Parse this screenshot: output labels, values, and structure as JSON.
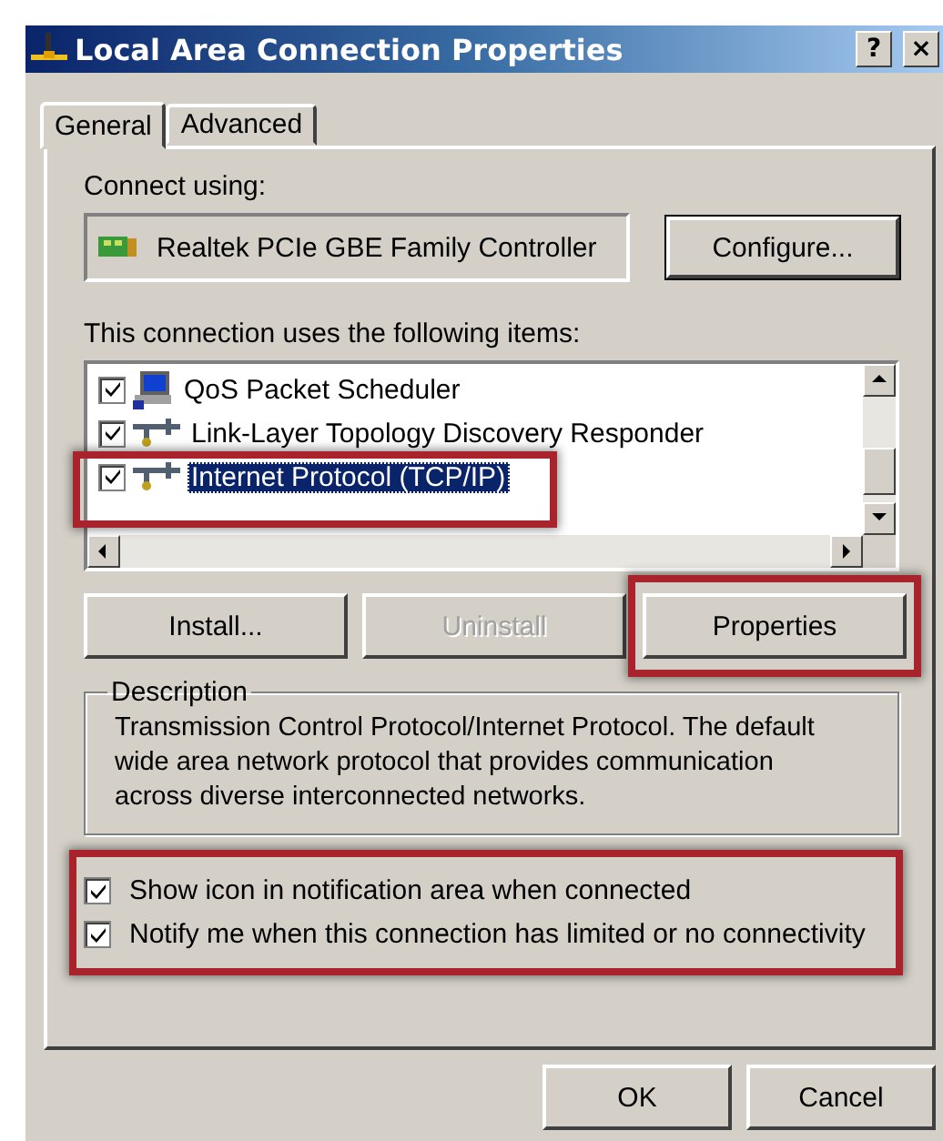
{
  "window": {
    "title": "Local Area Connection Properties",
    "buttons": [
      "?",
      "×"
    ]
  },
  "tabs": [
    {
      "label": "General",
      "selected": true
    },
    {
      "label": "Advanced",
      "selected": false
    }
  ],
  "connect_using": {
    "label": "Connect using:",
    "adapter": "Realtek PCIe GBE Family Controller",
    "button": "Configure..."
  },
  "components": {
    "label": "This connection uses the following items:",
    "items": [
      {
        "name": "QoS Packet Scheduler",
        "kind": "service",
        "checked": true,
        "selected": false,
        "highlighted": false
      },
      {
        "name": "Link-Layer Topology Discovery Responder",
        "kind": "protocol",
        "checked": true,
        "selected": false,
        "highlighted": false
      },
      {
        "name": "Internet Protocol (TCP/IP)",
        "kind": "protocol",
        "checked": true,
        "selected": true,
        "highlighted": true
      }
    ],
    "buttons": [
      {
        "label": "Install...",
        "disabled": false,
        "highlighted": false
      },
      {
        "label": "Uninstall",
        "disabled": true,
        "highlighted": false
      },
      {
        "label": "Properties",
        "disabled": false,
        "highlighted": true
      }
    ]
  },
  "description": {
    "title": "Description",
    "text": "Transmission Control Protocol/Internet Protocol. The default wide area network protocol that provides communication across diverse interconnected networks."
  },
  "options": {
    "highlighted": true,
    "items": [
      {
        "label": "Show icon in notification area when connected",
        "checked": true
      },
      {
        "label": "Notify me when this connection has limited or no connectivity",
        "checked": true
      }
    ]
  },
  "buttons": [
    "OK",
    "Cancel"
  ]
}
